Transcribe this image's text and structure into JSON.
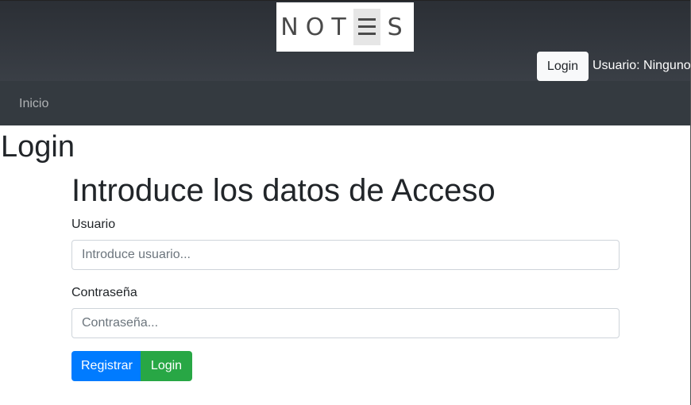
{
  "header": {
    "logo_text": "NOT",
    "logo_text_end": "S",
    "login_button": "Login",
    "user_label": "Usuario: Ninguno"
  },
  "nav": {
    "items": [
      {
        "label": "Inicio"
      }
    ]
  },
  "page": {
    "title": "Login"
  },
  "form": {
    "heading": "Introduce los datos de Acceso",
    "username_label": "Usuario",
    "username_placeholder": "Introduce usuario...",
    "password_label": "Contraseña",
    "password_placeholder": "Contraseña...",
    "register_button": "Registrar",
    "login_button": "Login"
  },
  "colors": {
    "header_bg": "#343a40",
    "primary": "#007bff",
    "success": "#28a745"
  }
}
